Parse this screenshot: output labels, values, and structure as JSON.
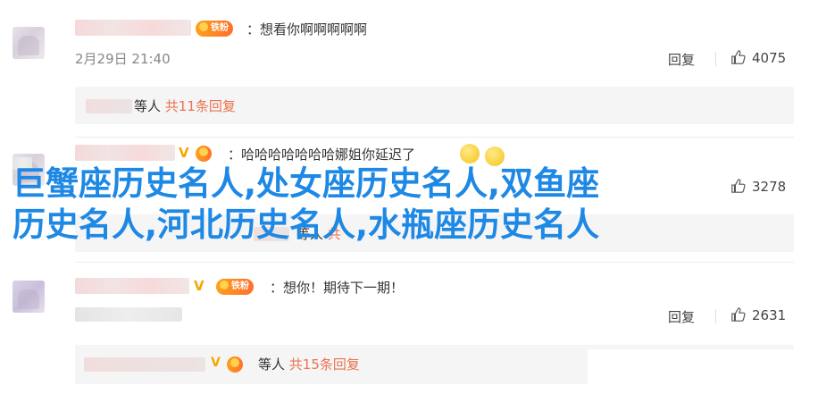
{
  "comments": [
    {
      "text": "：想看你啊啊啊啊啊",
      "fan_badge": "铁粉",
      "time": "2月29日 21:40",
      "reply_label": "回复",
      "likes": "4075",
      "sub": {
        "prefix": "等人",
        "link": "共11条回复"
      }
    },
    {
      "text": "：哈哈哈哈哈哈哈娜姐你延迟了",
      "fan_badge": "铁粉",
      "likes": "3278",
      "sub": {
        "prefix": "等人",
        "link": "共"
      }
    },
    {
      "text": "：想你！期待下一期！",
      "fan_badge": "铁粉",
      "reply_label": "回复",
      "likes": "2631",
      "sub": {
        "prefix": "等人",
        "link": "共15条回复"
      }
    }
  ],
  "overlay": {
    "line1": "巨蟹座历史名人,处女座历史名人,双鱼座",
    "line2": "历史名人,河北历史名人,水瓶座历史名人"
  },
  "colors": {
    "overlay": "#1e88e5",
    "link": "#eb7350",
    "fan_badge": "#ff8a1f",
    "verified": "#f7a600"
  },
  "icons": [
    "thumb-up-icon",
    "verified-icon",
    "fan-badge-icon",
    "emoji-icon"
  ]
}
